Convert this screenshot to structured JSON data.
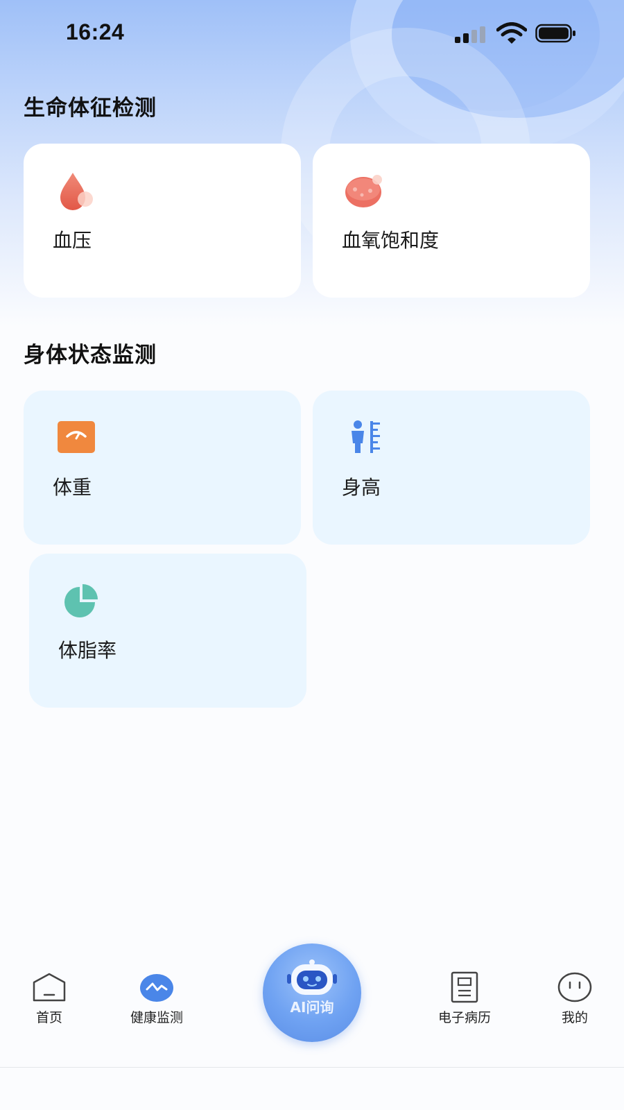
{
  "status_bar": {
    "time": "16:24"
  },
  "vital_signs": {
    "title": "生命体征检测",
    "cards": [
      {
        "label": "血压",
        "icon": "blood-drop-icon",
        "color": "#ee6a5c"
      },
      {
        "label": "血氧饱和度",
        "icon": "red-blood-cell-icon",
        "color": "#ef7a6c"
      }
    ]
  },
  "body_status": {
    "title": "身体状态监测",
    "cards": [
      {
        "label": "体重",
        "icon": "scale-icon",
        "color": "#f0883e"
      },
      {
        "label": "身高",
        "icon": "height-ruler-icon",
        "color": "#4a86e8"
      },
      {
        "label": "体脂率",
        "icon": "pie-chart-icon",
        "color": "#5ec2b0"
      }
    ]
  },
  "bottom_nav": {
    "items": [
      {
        "label": "首页",
        "icon": "home-icon",
        "active": false
      },
      {
        "label": "健康监测",
        "icon": "health-monitor-icon",
        "active": true
      },
      {
        "label": "AI问询",
        "icon": "robot-icon",
        "active": false
      },
      {
        "label": "电子病历",
        "icon": "medical-record-icon",
        "active": false
      },
      {
        "label": "我的",
        "icon": "profile-face-icon",
        "active": false
      }
    ]
  },
  "colors": {
    "accent": "#4a86e8",
    "header_gradient_top": "#9fc0f8",
    "card_blue": "#eaf6ff",
    "card_white": "#ffffff"
  }
}
